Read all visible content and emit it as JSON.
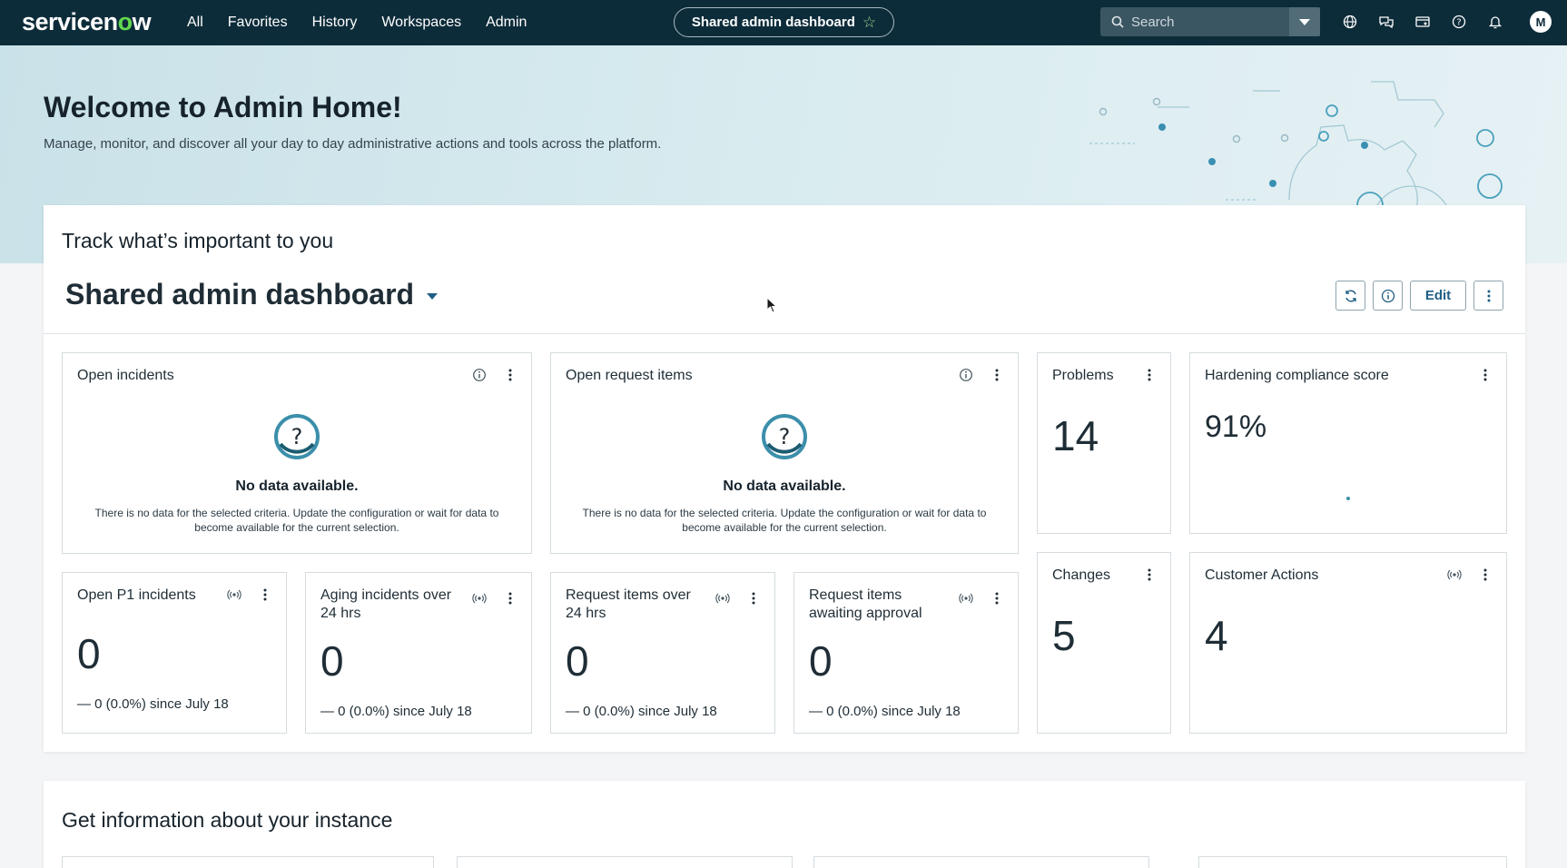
{
  "nav": {
    "brand_pre": "servicen",
    "brand_o": "o",
    "brand_post": "w",
    "links": [
      "All",
      "Favorites",
      "History",
      "Workspaces",
      "Admin"
    ],
    "pill_label": "Shared admin dashboard",
    "search_placeholder": "Search",
    "avatar_initial": "M"
  },
  "hero": {
    "title": "Welcome to Admin Home!",
    "subtitle": "Manage, monitor, and discover all your day to day administrative actions and tools across the platform."
  },
  "dashboard": {
    "section_heading": "Track what’s important to you",
    "title": "Shared admin dashboard",
    "edit_label": "Edit",
    "no_data_title": "No data available.",
    "no_data_text": "There is no data for the selected criteria. Update the configuration or wait for data to become available for the current selection.",
    "tiles": {
      "open_incidents": {
        "title": "Open incidents"
      },
      "open_request_items": {
        "title": "Open request items"
      },
      "problems": {
        "title": "Problems",
        "value": "14"
      },
      "hardening": {
        "title": "Hardening compliance score",
        "value": "91%"
      },
      "open_p1": {
        "title": "Open P1 incidents",
        "value": "0",
        "trend": "0 (0.0%)",
        "since": "since July 18"
      },
      "aging": {
        "title": "Aging incidents over 24 hrs",
        "value": "0",
        "trend": "0 (0.0%)",
        "since": "since July 18"
      },
      "req_over": {
        "title": "Request items over 24 hrs",
        "value": "0",
        "trend": "0 (0.0%)",
        "since": "since July 18"
      },
      "req_approval": {
        "title": "Request items awaiting approval",
        "value": "0",
        "trend": "0 (0.0%)",
        "since": "since July 18"
      },
      "changes": {
        "title": "Changes",
        "value": "5"
      },
      "customer_actions": {
        "title": "Customer Actions",
        "value": "4"
      }
    }
  },
  "instance": {
    "section_heading": "Get information about your instance"
  },
  "colors": {
    "nav_bg": "#0d2c3a",
    "accent_green": "#62d84e",
    "link_blue": "#1f5f86"
  }
}
